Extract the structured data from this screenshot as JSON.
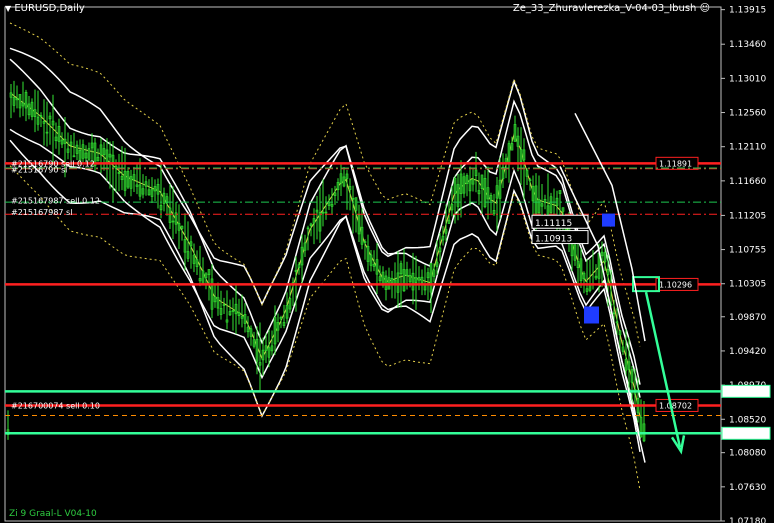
{
  "header": {
    "symbol_label": "EURUSD,Daily",
    "indicator_label": "Ze_33_Zhuravlerezka_V-04-03_Ibush"
  },
  "footer": {
    "text": "Zi 9 Graal-L V04-10"
  },
  "price_scale": {
    "ticks": [
      "1.13915",
      "1.13460",
      "1.13010",
      "1.12560",
      "1.12110",
      "1.11660",
      "1.11205",
      "1.10755",
      "1.10305",
      "1.09870",
      "1.09420",
      "1.08970",
      "1.08520",
      "1.08080",
      "1.07630",
      "1.07180"
    ]
  },
  "chart_data": {
    "type": "candlestick",
    "symbol": "EURUSD",
    "timeframe": "Daily",
    "ylim": [
      1.0718,
      1.1395
    ],
    "grid": false,
    "levels": [
      {
        "price": 1.11891,
        "label": "1.11891",
        "color": "#ff2020",
        "style": "solid"
      },
      {
        "price": 1.10296,
        "label": "1.10296",
        "color": "#ff2020",
        "style": "solid"
      },
      {
        "price": 1.08702,
        "label": "1.08702",
        "color": "#ff2020",
        "style": "solid"
      },
      {
        "price": 1.08888,
        "label": "1.08888",
        "color": "#33ff99",
        "style": "solid"
      },
      {
        "price": 1.08335,
        "label": "1.08335",
        "color": "#33ff99",
        "style": "solid"
      },
      {
        "price": 1.1182,
        "label": "",
        "color": "#ff2020",
        "style": "dashdot"
      },
      {
        "price": 1.1122,
        "label": "",
        "color": "#ff2020",
        "style": "dashdot"
      },
      {
        "price": 1.0857,
        "label": "",
        "color": "#ff8c00",
        "style": "dashed"
      },
      {
        "price": 1.1183,
        "label": "",
        "color": "#1ec850",
        "style": "dashdot"
      },
      {
        "price": 1.1138,
        "label": "",
        "color": "#1ec850",
        "style": "dashdot"
      }
    ],
    "orders": [
      {
        "label": "#21516790 sell 0.12",
        "price": 1.1189
      },
      {
        "label": "#21516790 sl",
        "price": 1.1181
      },
      {
        "label": "#215167987 sell 0.12",
        "price": 1.114
      },
      {
        "label": "#215167987 sl",
        "price": 1.1125
      },
      {
        "label": "#216700074 sell 0.10",
        "price": 1.087
      }
    ],
    "markers": [
      {
        "label": "1.11115",
        "price": 1.11115
      },
      {
        "label": "1.10913",
        "price": 1.10913
      }
    ]
  }
}
